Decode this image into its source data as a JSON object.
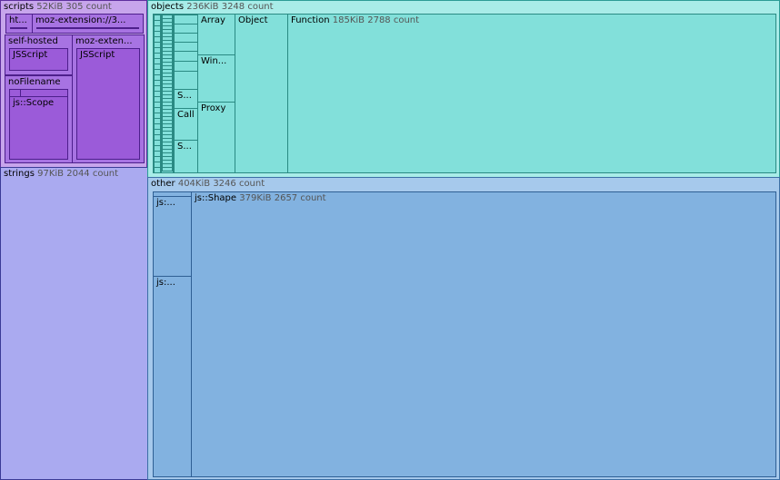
{
  "scripts": {
    "name": "scripts",
    "size": "52KiB",
    "count": "305 count",
    "ht_short": "ht...",
    "moz_ext": "moz-extension://3...",
    "self_hosted": "self-hosted",
    "self_hosted_child": "JSScript",
    "moz_ext_short": "moz-exten...",
    "moz_ext_child": "JSScript",
    "no_filename": "noFilename",
    "no_filename_child": "js::Scope"
  },
  "strings": {
    "name": "strings",
    "size": "97KiB",
    "count": "2044 count"
  },
  "objects": {
    "name": "objects",
    "size": "236KiB",
    "count": "3248 count",
    "array": "Array",
    "win": "Win...",
    "proxy": "Proxy",
    "s1": "S...",
    "call": "Call",
    "s2": "S...",
    "object": "Object",
    "function": "Function",
    "function_size": "185KiB",
    "function_count": "2788 count"
  },
  "other": {
    "name": "other",
    "size": "404KiB",
    "count": "3246 count",
    "js1": "js:...",
    "js2": "js:...",
    "shape": "js::Shape",
    "shape_size": "379KiB",
    "shape_count": "2657 count"
  }
}
